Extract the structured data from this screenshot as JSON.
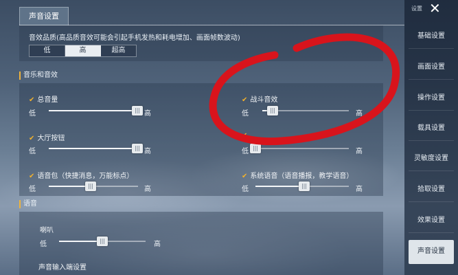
{
  "header": {
    "tab_title": "声音设置"
  },
  "quality": {
    "label": "音效品质(高品质音效可能会引起手机发热和耗电增加、画面帧数波动)",
    "options": [
      "低",
      "高",
      "超高"
    ],
    "selected": "高"
  },
  "music_section": {
    "title": "音乐和音效",
    "sliders": [
      {
        "label": "总音量",
        "low": "低",
        "high": "高",
        "checked": true,
        "value": 0.99
      },
      {
        "label": "战斗音效",
        "low": "低",
        "high": "高",
        "checked": true,
        "value": 0.12
      },
      {
        "label": "大厅按钮",
        "low": "低",
        "high": "高",
        "checked": true,
        "value": 0.99
      },
      {
        "label": "",
        "low": "低",
        "high": "高",
        "checked": true,
        "value": 0.0
      },
      {
        "label": "语音包（快捷消息，万能标点）",
        "low": "低",
        "high": "高",
        "checked": true,
        "value": 0.47
      },
      {
        "label": "系统语音（语音播报，教学语音）",
        "low": "低",
        "high": "高",
        "checked": true,
        "value": 0.52
      }
    ]
  },
  "voice_section": {
    "title": "语音",
    "speaker": {
      "label": "喇叭",
      "low": "低",
      "high": "高",
      "value": 0.5
    },
    "input_label": "声音输入端设置"
  },
  "sidebar": {
    "header_label": "设置",
    "items": [
      "基础设置",
      "画面设置",
      "操作设置",
      "载具设置",
      "灵敏度设置",
      "拾取设置",
      "效果设置",
      "声音设置"
    ],
    "active": "声音设置"
  },
  "colors": {
    "accent": "#f0b43c",
    "check": "#f2b12b",
    "annotation": "#d8141c"
  }
}
